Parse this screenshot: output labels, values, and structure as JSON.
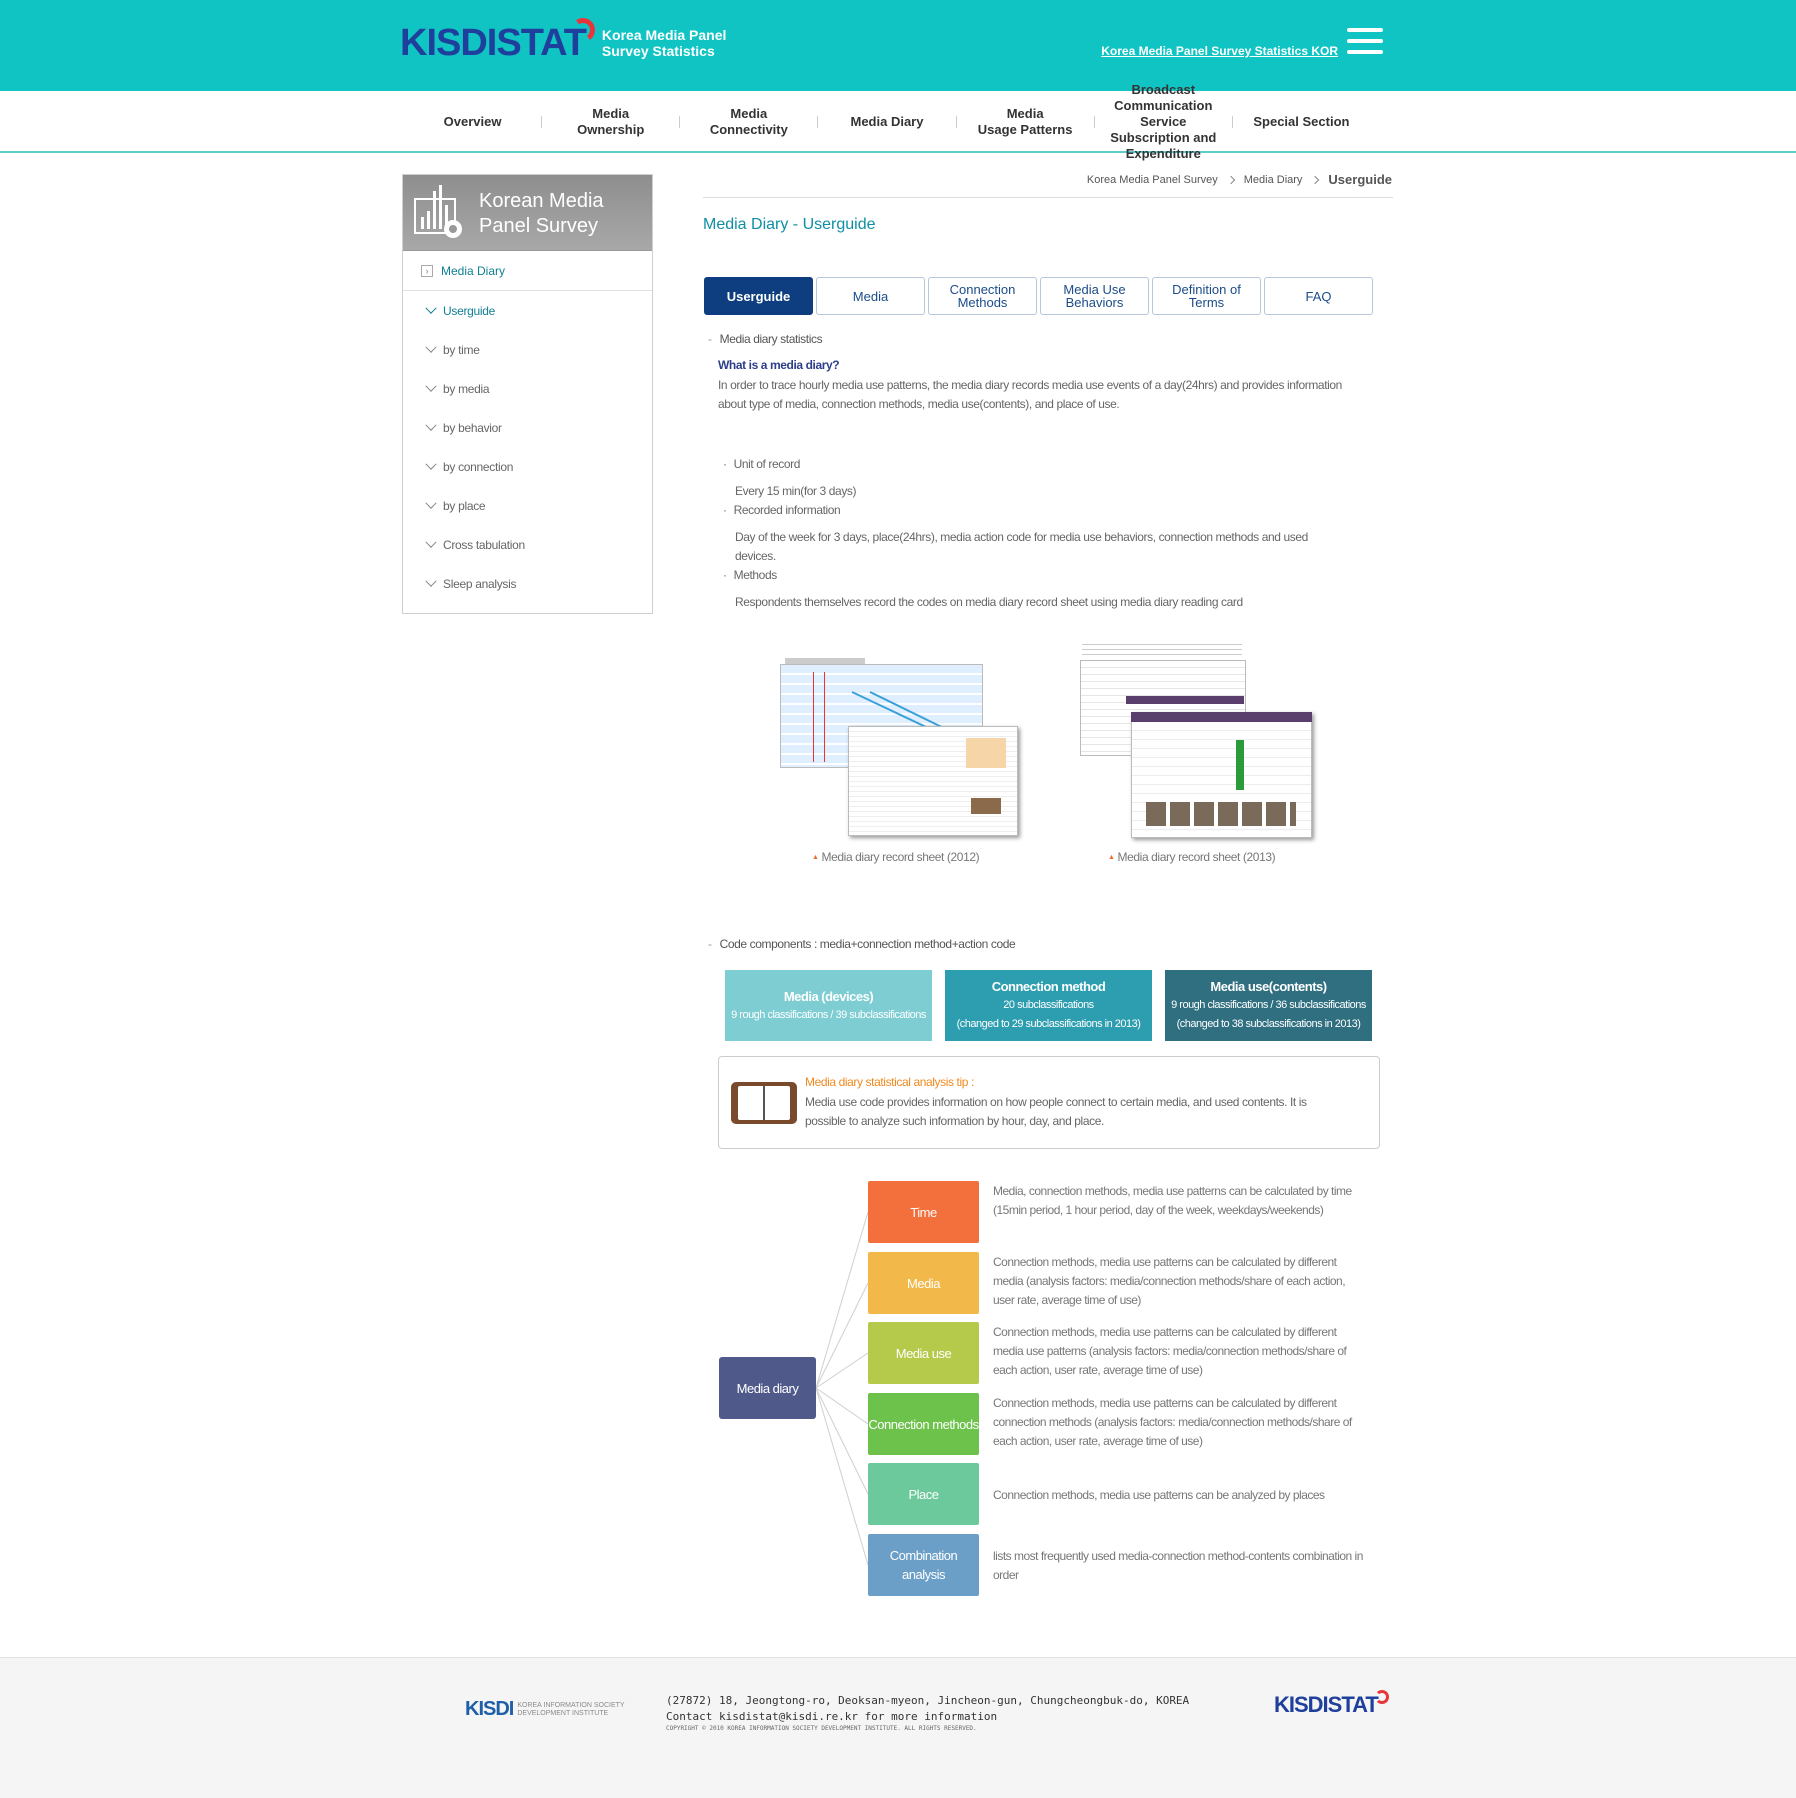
{
  "header": {
    "logo_text": "KISDISTAT",
    "logo_sub_line1": "Korea Media Panel",
    "logo_sub_line2": "Survey Statistics",
    "kor_link": "Korea Media Panel Survey Statistics KOR"
  },
  "gnb": [
    {
      "label": "Overview"
    },
    {
      "label": "Media\nOwnership"
    },
    {
      "label": "Media\nConnectivity"
    },
    {
      "label": "Media Diary"
    },
    {
      "label": "Media\nUsage Patterns"
    },
    {
      "label": "Broadcast Communication\nService Subscription and Expenditure"
    },
    {
      "label": "Special Section"
    }
  ],
  "sidebar": {
    "title_line1": "Korean Media",
    "title_line2": "Panel Survey",
    "category": "Media Diary",
    "items": [
      {
        "label": "Userguide"
      },
      {
        "label": "by time"
      },
      {
        "label": "by media"
      },
      {
        "label": "by behavior"
      },
      {
        "label": "by connection"
      },
      {
        "label": "by place"
      },
      {
        "label": "Cross tabulation"
      },
      {
        "label": "Sleep analysis"
      }
    ]
  },
  "breadcrumb": {
    "home": "Korea Media Panel Survey",
    "section": "Media Diary",
    "current": "Userguide"
  },
  "page_title": "Media Diary - Userguide",
  "tabs": [
    {
      "label": "Userguide"
    },
    {
      "label": "Media"
    },
    {
      "label": "Connection\nMethods"
    },
    {
      "label": "Media Use\nBehaviors"
    },
    {
      "label": "Definition of\nTerms"
    },
    {
      "label": "FAQ"
    }
  ],
  "content": {
    "section1_heading": "Media diary statistics",
    "question": "What is a media diary?",
    "intro_line1": "In order to trace hourly media use patterns, the media diary records media use events of a day(24hrs) and provides information",
    "intro_line2": "about type of media, connection methods, media use(contents), and place of use.",
    "unit_label": "Unit of record",
    "unit_value": "Every 15 min(for 3 days)",
    "recorded_label": "Recorded information",
    "recorded_line1": "Day of the week for 3 days, place(24hrs), media action code for media use behaviors, connection methods and used",
    "recorded_line2": "devices.",
    "methods_label": "Methods",
    "methods_value": "Respondents themselves record the codes on media diary record sheet using media diary reading card",
    "caption_2012": "Media diary record sheet (2012)",
    "caption_2013": "Media diary record sheet (2013)",
    "section2_heading": "Code components : media+connection method+action code"
  },
  "code_boxes": [
    {
      "title": "Media (devices)",
      "line1": "9 rough classifications / 39 subclassifications",
      "line2": "",
      "color": "#7dcdd3"
    },
    {
      "title": "Connection method",
      "line1": "20 subclassifications",
      "line2": "(changed to 29 subclassifications in 2013)",
      "color": "#2d9db0"
    },
    {
      "title": "Media use(contents)",
      "line1": "9 rough classifications / 36 subclassifications",
      "line2": "(changed to 38 subclassifications in 2013)",
      "color": "#2f6f80"
    }
  ],
  "tip": {
    "heading": "Media diary statistical analysis tip :",
    "body": "Media use code provides information on how people connect to certain media, and used contents. It is possible to analyze such information by hour, day, and place."
  },
  "diagram": {
    "root": "Media diary",
    "nodes": [
      {
        "label": "Time",
        "color": "#f36f3b",
        "desc": "Media, connection methods, media use patterns can be calculated by time (15min period, 1 hour period, day of the week, weekdays/weekends)"
      },
      {
        "label": "Media",
        "color": "#f2b84a",
        "desc": "Connection methods, media use patterns can be calculated by different media (analysis factors: media/connection methods/share of each action, user rate, average time of use)"
      },
      {
        "label": "Media use",
        "color": "#b5c94a",
        "desc": "Connection methods, media use patterns can be calculated by different media use patterns (analysis factors: media/connection methods/share of each action, user rate, average time of use)"
      },
      {
        "label": "Connection methods",
        "color": "#6cc24a",
        "desc": "Connection methods, media use patterns can be calculated by different connection methods (analysis factors: media/connection methods/share of each action, user rate, average time of use)"
      },
      {
        "label": "Place",
        "color": "#6cc99b",
        "desc": "Connection methods, media use patterns can be analyzed by places"
      },
      {
        "label": "Combination analysis",
        "color": "#6b9fc8",
        "desc": "lists most frequently used media-connection method-contents combination in order"
      }
    ]
  },
  "footer": {
    "kisdi": "KISDI",
    "kisdi_sub1": "KOREA INFORMATION SOCIETY",
    "kisdi_sub2": "DEVELOPMENT INSTITUTE",
    "address": "(27872) 18, Jeongtong-ro, Deoksan-myeon, Jincheon-gun, Chungcheongbuk-do, KOREA",
    "contact": "Contact kisdistat@kisdi.re.kr for more information",
    "copyright": "COPYRIGHT © 2010 KOREA INFORMATION SOCIETY DEVELOPMENT INSTITUTE. ALL RIGHTS RESERVED.",
    "logo": "KISDISTAT"
  }
}
